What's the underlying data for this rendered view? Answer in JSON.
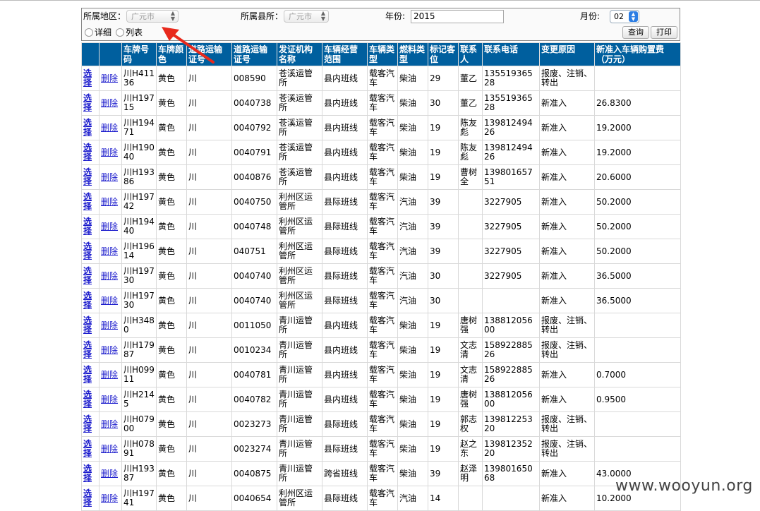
{
  "filters": {
    "region_label": "所属地区：",
    "region_value": "广元市",
    "county_label": "所属县所：",
    "county_value": "广元市",
    "year_label": "年份:",
    "year_value": "2015",
    "month_label": "月份:",
    "month_value": "02",
    "view_detail": "详细",
    "view_list": "列表",
    "query_button": "查询",
    "print_button": "打印"
  },
  "table": {
    "headers": [
      "",
      "",
      "车牌号码",
      "车牌颜色",
      "道路运输证号",
      "道路运输证号",
      "发证机构名称",
      "车辆经营范围",
      "车辆类型",
      "燃料类型",
      "标记客位",
      "联系人",
      "联系电话",
      "变更原因",
      "新准入车辆购置费（万元）"
    ],
    "select_label": "选择",
    "delete_label": "删除",
    "rows": [
      [
        "川H41136",
        "黄色",
        "川",
        "008590",
        "苍溪运管所",
        "县内班线",
        "载客汽车",
        "柴油",
        "29",
        "董乙",
        "13551936528",
        "报废、注销、转出",
        ""
      ],
      [
        "川H19715",
        "黄色",
        "川",
        "0040738",
        "苍溪运管所",
        "县内班线",
        "载客汽车",
        "柴油",
        "30",
        "董乙",
        "13551936528",
        "新准入",
        "26.8300"
      ],
      [
        "川H19471",
        "黄色",
        "川",
        "0040792",
        "苍溪运管所",
        "县内班线",
        "载客汽车",
        "柴油",
        "19",
        "陈友彪",
        "13981249426",
        "新准入",
        "19.2000"
      ],
      [
        "川H19040",
        "黄色",
        "川",
        "0040791",
        "苍溪运管所",
        "县内班线",
        "载客汽车",
        "柴油",
        "19",
        "陈友彪",
        "13981249426",
        "新准入",
        "19.2000"
      ],
      [
        "川H19386",
        "黄色",
        "川",
        "0040876",
        "苍溪运管所",
        "县内班线",
        "载客汽车",
        "柴油",
        "19",
        "曹树全",
        "13980165751",
        "新准入",
        "20.6000"
      ],
      [
        "川H19742",
        "黄色",
        "川",
        "0040750",
        "利州区运管所",
        "县际班线",
        "载客汽车",
        "汽油",
        "39",
        "",
        "3227905",
        "新准入",
        "50.2000"
      ],
      [
        "川H19440",
        "黄色",
        "川",
        "0040748",
        "利州区运管所",
        "县际班线",
        "载客汽车",
        "汽油",
        "39",
        "",
        "3227905",
        "新准入",
        "50.2000"
      ],
      [
        "川H19614",
        "黄色",
        "川",
        "040751",
        "利州区运管所",
        "县际班线",
        "载客汽车",
        "汽油",
        "39",
        "",
        "3227905",
        "新准入",
        "50.2000"
      ],
      [
        "川H19730",
        "黄色",
        "川",
        "0040740",
        "利州区运管所",
        "县际班线",
        "载客汽车",
        "汽油",
        "30",
        "",
        "3227905",
        "新准入",
        "36.5000"
      ],
      [
        "川H19730",
        "黄色",
        "川",
        "0040740",
        "利州区运管所",
        "县际班线",
        "载客汽车",
        "汽油",
        "30",
        "",
        "",
        "新准入",
        "36.5000"
      ],
      [
        "川H3480",
        "黄色",
        "川",
        "0011050",
        "青川运管所",
        "县内班线",
        "载客汽车",
        "柴油",
        "19",
        "唐树强",
        "13881205600",
        "报废、注销、转出",
        ""
      ],
      [
        "川H17987",
        "黄色",
        "川",
        "0010234",
        "青川运管所",
        "县内班线",
        "载客汽车",
        "柴油",
        "19",
        "文志清",
        "15892288526",
        "报废、注销、转出",
        ""
      ],
      [
        "川H09911",
        "黄色",
        "川",
        "0040781",
        "青川运管所",
        "县内班线",
        "载客汽车",
        "柴油",
        "19",
        "文志清",
        "15892288526",
        "新准入",
        "0.7000"
      ],
      [
        "川H2145",
        "黄色",
        "川",
        "0040782",
        "青川运管所",
        "县内班线",
        "载客汽车",
        "柴油",
        "19",
        "唐树强",
        "13881205600",
        "新准入",
        "0.9500"
      ],
      [
        "川H07900",
        "黄色",
        "川",
        "0023273",
        "青川运管所",
        "县际班线",
        "载客汽车",
        "柴油",
        "19",
        "郭志权",
        "13981225320",
        "报废、注销、转出",
        ""
      ],
      [
        "川H07891",
        "黄色",
        "川",
        "0023274",
        "青川运管所",
        "县际班线",
        "载客汽车",
        "柴油",
        "19",
        "赵之东",
        "13981235220",
        "报废、注销、转出",
        ""
      ],
      [
        "川H19387",
        "黄色",
        "川",
        "0040875",
        "青川运管所",
        "跨省班线",
        "载客汽车",
        "柴油",
        "39",
        "赵泽明",
        "13980165068",
        "新准入",
        "43.0000"
      ],
      [
        "川H19741",
        "黄色",
        "川",
        "0040654",
        "利州区运管所",
        "县际班线",
        "载客汽车",
        "汽油",
        "14",
        "",
        "",
        "新准入",
        "10.2000"
      ]
    ]
  },
  "watermark": "www.wooyun.org",
  "colors": {
    "header_bg": "#005f9e",
    "link": "#1a1acc",
    "annotation_arrow": "#e8291c"
  }
}
